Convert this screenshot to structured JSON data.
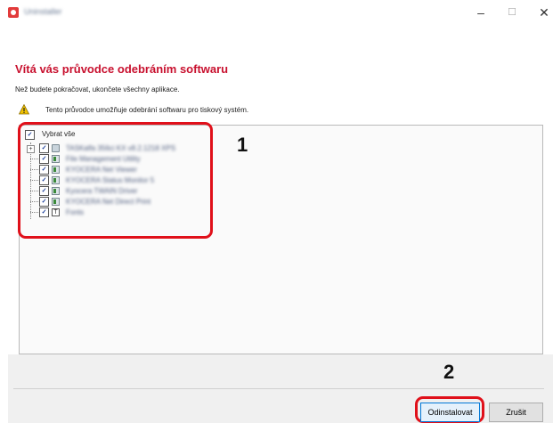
{
  "window": {
    "title": "Uninstaller",
    "controls": {
      "minimize": "–",
      "maximize": "☐",
      "close": "✕"
    }
  },
  "header": {
    "title": "Vítá vás průvodce odebráním softwaru",
    "subtitle": "Než budete pokračovat, ukončete všechny aplikace.",
    "info_text": "Tento průvodce umožňuje odebrání softwaru pro tiskový systém."
  },
  "tree": {
    "select_all_label": "Vybrat vše",
    "select_all_checked": true,
    "items": [
      {
        "label": "TASKalfa 356ci KX v8.2.1218 XPS",
        "checked": true,
        "expander": "+",
        "icon": "printer-icon"
      },
      {
        "label": "File Management Utility",
        "checked": true,
        "icon": "app-icon"
      },
      {
        "label": "KYOCERA Net Viewer",
        "checked": true,
        "icon": "app-icon"
      },
      {
        "label": "KYOCERA Status Monitor 5",
        "checked": true,
        "icon": "app-icon"
      },
      {
        "label": "Kyocera TWAIN Driver",
        "checked": true,
        "icon": "app-icon"
      },
      {
        "label": "KYOCERA Net Direct Print",
        "checked": true,
        "icon": "app-icon"
      },
      {
        "label": "Fonts",
        "checked": true,
        "icon": "font-icon"
      }
    ]
  },
  "annotations": {
    "callout_1": "1",
    "callout_2": "2",
    "color": "#e0101a"
  },
  "footer": {
    "uninstall_label": "Odinstalovat",
    "cancel_label": "Zrušit"
  },
  "colors": {
    "title_red": "#c8102e",
    "primary_button_border": "#0078d7"
  }
}
